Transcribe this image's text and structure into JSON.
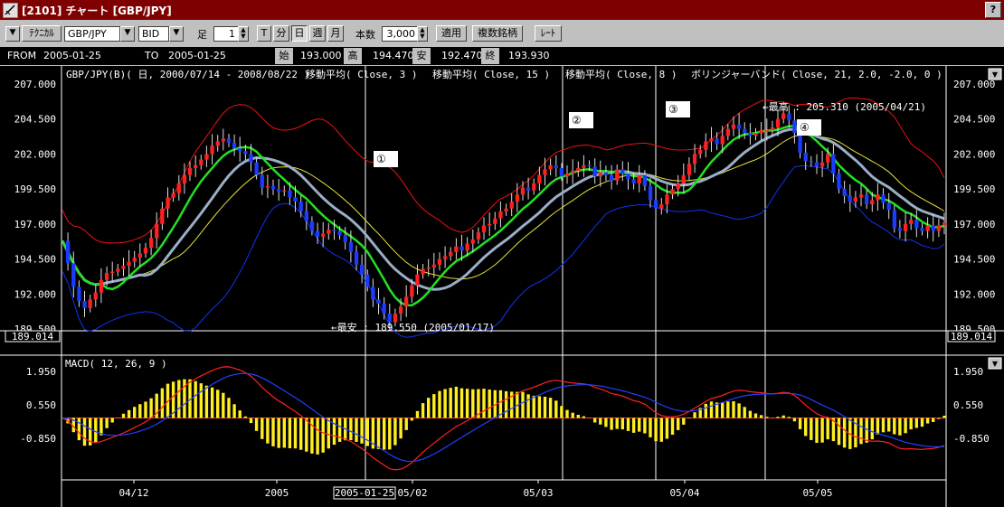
{
  "window": {
    "title": "[2101] チャート [GBP/JPY]",
    "help_label": "?"
  },
  "toolbar": {
    "technical_label": "ﾃｸﾆｶﾙ",
    "symbol": "GBP/JPY",
    "price_type": "BID",
    "interval_label": "足",
    "interval_value": "1",
    "period_t": "T",
    "period_min": "分",
    "period_day": "日",
    "period_week": "週",
    "period_month": "月",
    "count_label": "本数",
    "count_value": "3,000",
    "apply_label": "適用",
    "multi_symbol_label": "複数銘柄",
    "rate_label": "ﾚｰﾄ"
  },
  "info": {
    "from_label": "FROM",
    "from_date": "2005-01-25",
    "to_label": "TO",
    "to_date": "2005-01-25",
    "open_label": "始",
    "open": "193.000",
    "high_label": "高",
    "high": "194.470",
    "low_label": "安",
    "low": "192.470",
    "close_label": "終",
    "close": "193.930"
  },
  "main_chart": {
    "header": "GBP/JPY(B)( 日, 2000/07/14 - 2008/08/22 )",
    "indicator_labels": [
      "移動平均( Close, 3 )",
      "移動平均( Close, 15 )",
      "移動平均( Close, 8 )",
      "ボリンジャーバンド( Close, 21, 2.0, -2.0, 0 )"
    ],
    "y_ticks": [
      "207.000",
      "204.500",
      "202.000",
      "199.500",
      "197.000",
      "194.500",
      "192.000",
      "189.500"
    ],
    "y_tick_values": [
      207,
      204.5,
      202,
      199.5,
      197,
      194.5,
      192,
      189.5
    ],
    "crosshair_value": "189.014",
    "markers": [
      "①",
      "②",
      "③",
      "④"
    ],
    "high_annotation": "←最高 : 205.310 (2005/04/21)",
    "low_annotation": "←最安 : 189.550 (2005/01/17)"
  },
  "macd_chart": {
    "header": "MACD( 12, 26, 9 )",
    "y_ticks": [
      "1.950",
      "0.550",
      "-0.850"
    ],
    "y_tick_values": [
      1.95,
      0.55,
      -0.85
    ]
  },
  "x_axis": {
    "labels": [
      "04/12",
      "2005",
      "05/02",
      "05/03",
      "05/04",
      "05/05"
    ],
    "cursor_label": "2005-01-25"
  },
  "chart_data": {
    "type": "candlestick",
    "title": "GBP/JPY(B)( 日, 2000/07/14 - 2008/08/22 )",
    "ylim": [
      189.0,
      208.0
    ],
    "closes": [
      195.8,
      194.2,
      192.5,
      191.5,
      191.0,
      191.6,
      192.1,
      193.0,
      193.5,
      193.6,
      193.8,
      194.0,
      194.3,
      194.6,
      194.9,
      195.3,
      196.0,
      197.0,
      198.1,
      198.9,
      199.2,
      199.9,
      200.5,
      201.0,
      201.2,
      201.6,
      202.0,
      202.6,
      202.9,
      203.1,
      202.8,
      202.4,
      202.2,
      202.0,
      201.4,
      200.5,
      199.6,
      199.7,
      199.5,
      199.3,
      199.4,
      198.9,
      198.6,
      197.9,
      197.2,
      196.5,
      196.1,
      196.3,
      196.6,
      196.5,
      196.2,
      195.7,
      195.0,
      194.1,
      193.4,
      192.5,
      191.6,
      191.3,
      190.6,
      190.0,
      190.6,
      191.1,
      191.8,
      192.6,
      193.4,
      193.8,
      193.9,
      194.1,
      194.5,
      194.7,
      195.0,
      195.4,
      195.1,
      195.6,
      195.9,
      196.4,
      196.9,
      197.0,
      197.4,
      197.9,
      198.1,
      198.6,
      199.1,
      199.6,
      199.4,
      199.9,
      200.5,
      200.9,
      201.2,
      201.0,
      200.4,
      200.6,
      200.8,
      201.0,
      201.2,
      201.1,
      200.4,
      200.7,
      200.5,
      200.1,
      200.9,
      200.6,
      200.2,
      199.9,
      200.5,
      199.7,
      198.7,
      198.1,
      198.4,
      199.1,
      199.5,
      199.9,
      200.5,
      201.3,
      202.0,
      202.3,
      202.9,
      203.1,
      202.7,
      203.3,
      203.8,
      204.1,
      203.8,
      203.5,
      203.3,
      203.5,
      203.7,
      203.7,
      203.9,
      204.5,
      204.9,
      204.4,
      203.5,
      202.1,
      201.5,
      201.4,
      201.1,
      201.4,
      202.0,
      200.6,
      199.5,
      199.0,
      198.6,
      198.9,
      199.1,
      198.4,
      198.7,
      199.1,
      198.5,
      198.0,
      196.7,
      196.5,
      197.0,
      197.3,
      196.7,
      196.5,
      196.9,
      196.5,
      196.9,
      197.1
    ]
  }
}
